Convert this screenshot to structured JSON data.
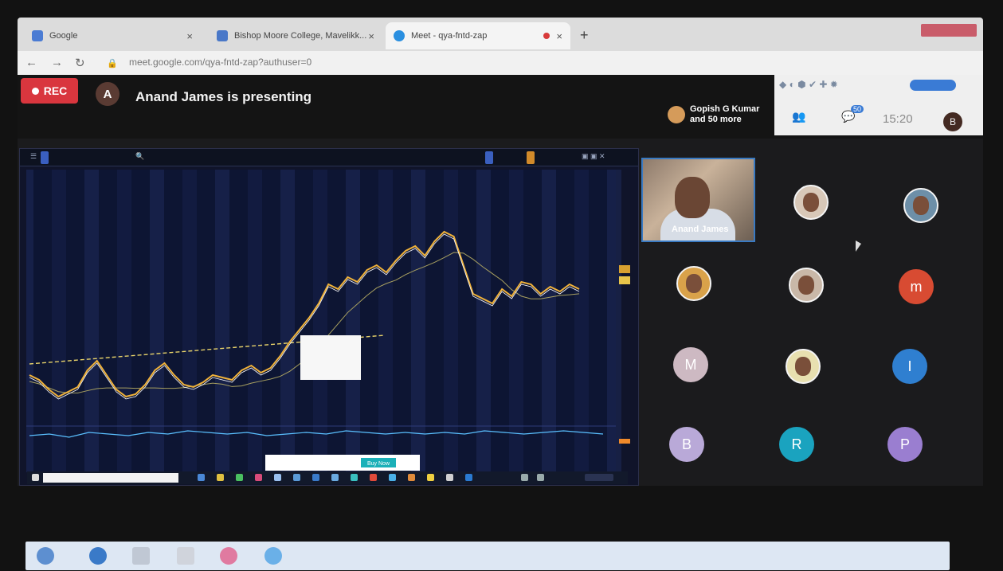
{
  "browser": {
    "tabs": [
      {
        "label": "Google",
        "favicon_color": "#4a7bd3"
      },
      {
        "label": "Bishop Moore College, Mavelikk...",
        "favicon_color": "#4a78c8"
      },
      {
        "label": "Meet - qya-fntd-zap",
        "favicon_color": "#2a8fe0"
      }
    ],
    "new_tab": "+",
    "url": "meet.google.com/qya-fntd-zap?authuser=0"
  },
  "meet": {
    "rec_label": "REC",
    "presenter_initial": "A",
    "presenting_text": "Anand James is presenting",
    "people_text_line1": "Gopish G Kumar",
    "people_text_line2": "and 50 more",
    "clock": "15:20",
    "user_initial": "B",
    "chat_count": "50"
  },
  "video_tile": {
    "name": "Anand James"
  },
  "participants": [
    {
      "initial": "",
      "color": "#d8c8b8",
      "kind": "photo"
    },
    {
      "initial": "",
      "color": "#6d8fa8",
      "kind": "photo"
    },
    {
      "initial": "",
      "color": "#d9a24a",
      "kind": "photo"
    },
    {
      "initial": "",
      "color": "#c9b8a8",
      "kind": "photo"
    },
    {
      "initial": "m",
      "color": "#d84b32",
      "kind": "letter"
    },
    {
      "initial": "M",
      "color": "#cdb9c2",
      "kind": "letter"
    },
    {
      "initial": "",
      "color": "#e8e0b0",
      "kind": "photo"
    },
    {
      "initial": "I",
      "color": "#2f7fd0",
      "kind": "letter"
    },
    {
      "initial": "B",
      "color": "#b9a9d8",
      "kind": "letter"
    },
    {
      "initial": "R",
      "color": "#1aa3bf",
      "kind": "letter"
    },
    {
      "initial": "P",
      "color": "#9a7ed0",
      "kind": "letter"
    }
  ],
  "trading": {
    "accent": "#3a5fbf",
    "button_label": "Buy Now",
    "price_series": [
      14,
      12,
      8,
      5,
      7,
      9,
      16,
      20,
      14,
      8,
      5,
      6,
      10,
      16,
      19,
      14,
      10,
      9,
      11,
      14,
      13,
      12,
      16,
      18,
      15,
      17,
      22,
      28,
      33,
      38,
      44,
      52,
      50,
      55,
      53,
      58,
      60,
      57,
      62,
      66,
      68,
      64,
      70,
      74,
      72,
      60,
      48,
      46,
      44,
      50,
      47,
      53,
      52,
      48,
      51,
      49,
      52,
      50
    ],
    "oscillator_series": [
      4,
      5,
      3,
      6,
      5,
      4,
      6,
      5,
      7,
      6,
      5,
      6,
      4,
      5,
      6,
      5,
      7,
      6,
      5,
      6,
      5,
      6,
      5,
      7,
      6,
      5,
      6,
      7,
      6,
      5
    ]
  }
}
